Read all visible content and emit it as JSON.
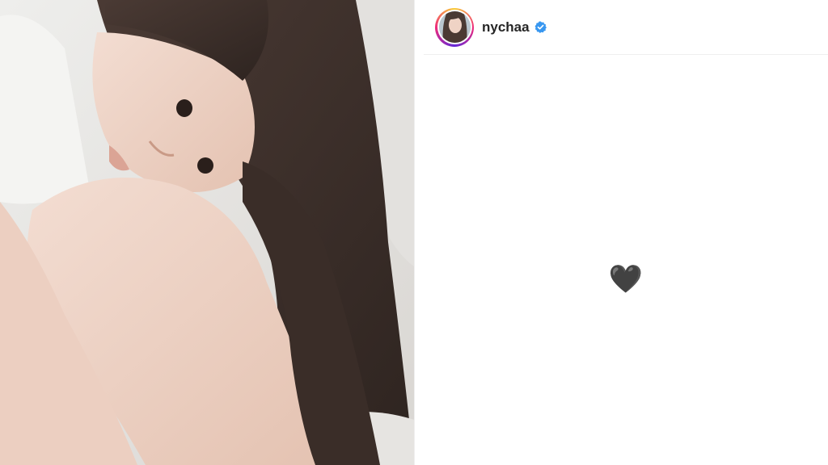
{
  "post": {
    "image": {
      "description_icon": "photo-portrait"
    },
    "author": {
      "username": "nychaa",
      "verified": true,
      "verified_color": "#3897f0"
    },
    "caption_text": "🖤"
  },
  "colors": {
    "story_ring": [
      "#f9ce34",
      "#ee2a7b",
      "#6228d7"
    ],
    "text": "#262626",
    "divider": "#efefef"
  }
}
